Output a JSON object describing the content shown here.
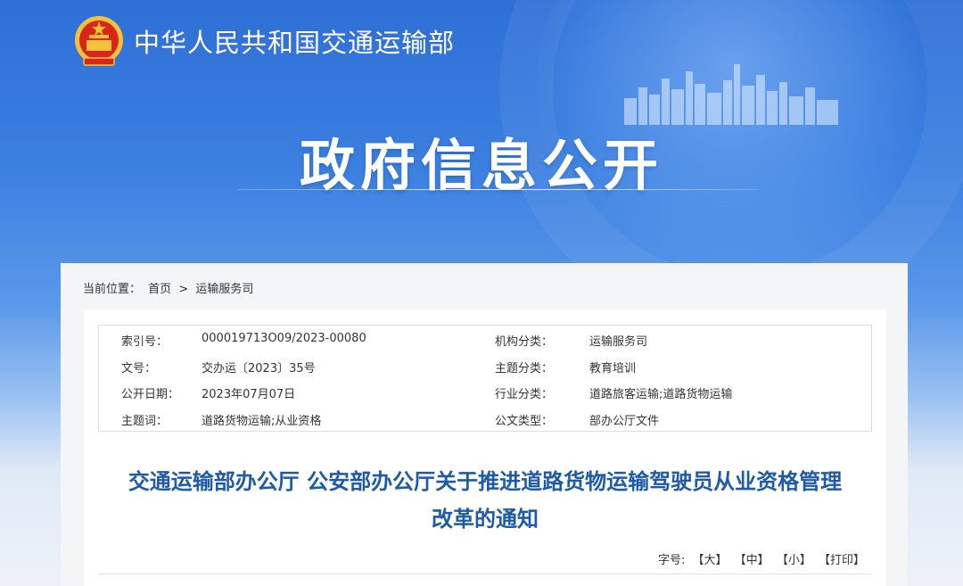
{
  "site": {
    "title": "中华人民共和国交通运输部"
  },
  "hero": {
    "title": "政府信息公开"
  },
  "breadcrumb": {
    "prefix": "当前位置：",
    "home": "首页",
    "sep": ">",
    "current": "运输服务司"
  },
  "meta": {
    "rows": [
      {
        "l1": "索引号：",
        "v1": "000019713O09/2023-00080",
        "l2": "机构分类：",
        "v2": "运输服务司"
      },
      {
        "l1": "文号：",
        "v1": "交办运〔2023〕35号",
        "l2": "主题分类：",
        "v2": "教育培训"
      },
      {
        "l1": "公开日期：",
        "v1": "2023年07月07日",
        "l2": "行业分类：",
        "v2": "道路旅客运输;道路货物运输"
      },
      {
        "l1": "主题词：",
        "v1": "道路货物运输;从业资格",
        "l2": "公文类型：",
        "v2": "部办公厅文件"
      }
    ]
  },
  "document": {
    "title_line1": "交通运输部办公厅 公安部办公厅关于推进道路货物运输驾驶员从业资格管理",
    "title_line2": "改革的通知"
  },
  "fontsize": {
    "label": "字号:",
    "large": "【大】",
    "medium": "【中】",
    "small": "【小】",
    "print": "【打印】"
  },
  "colors": {
    "header_blue": "#2f6fd6",
    "title_blue": "#1d5aa8",
    "emblem_red": "#d8261c",
    "emblem_gold": "#f3c23a"
  }
}
